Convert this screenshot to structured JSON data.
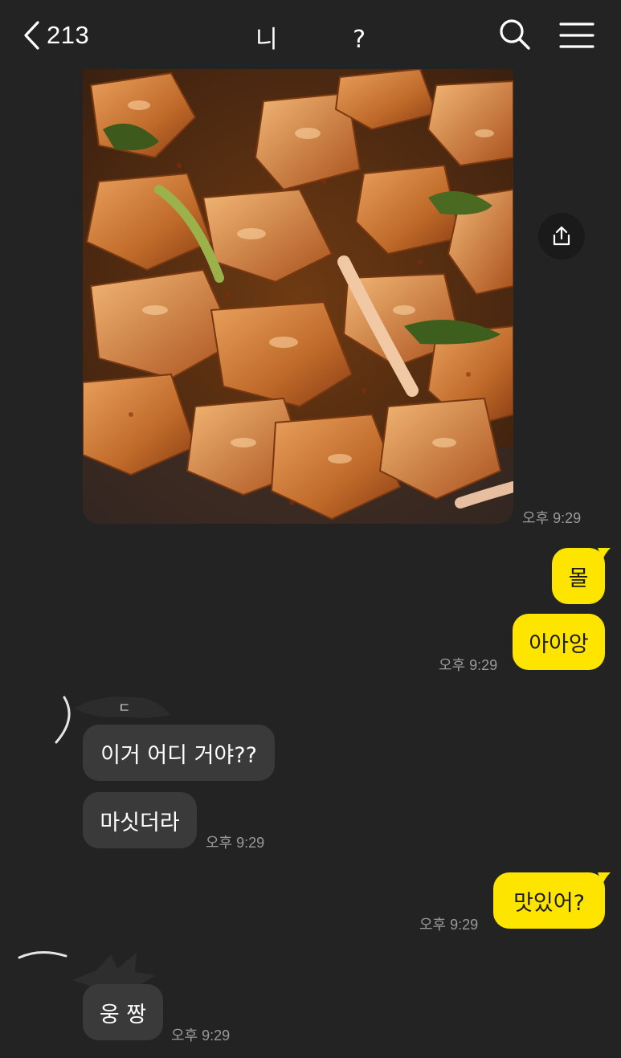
{
  "header": {
    "back_count": "213",
    "chat_title": "니 ?"
  },
  "messages": [
    {
      "id": "photo",
      "from": "other",
      "type": "image",
      "time": "오후 9:29"
    },
    {
      "id": "m1",
      "from": "me",
      "text": "몰"
    },
    {
      "id": "m2",
      "from": "me",
      "text": "아아앙",
      "time": "오후 9:29"
    },
    {
      "id": "m3",
      "from": "other",
      "sender_name": "ㄷ",
      "text": "이거 어디 거야??"
    },
    {
      "id": "m4",
      "from": "other",
      "text": "마싯더라",
      "time": "오후 9:29"
    },
    {
      "id": "m5",
      "from": "me",
      "text": "맛있어?",
      "time": "오후 9:29"
    },
    {
      "id": "m6",
      "from": "other",
      "text": "웅 짱",
      "time": "오후 9:29"
    }
  ],
  "colors": {
    "background": "#232323",
    "my_bubble": "#fee500",
    "their_bubble": "#3a3a3a",
    "timestamp": "#9a9a9a"
  },
  "icons": [
    "chevron-left-icon",
    "search-icon",
    "hamburger-menu-icon",
    "share-upload-icon"
  ]
}
